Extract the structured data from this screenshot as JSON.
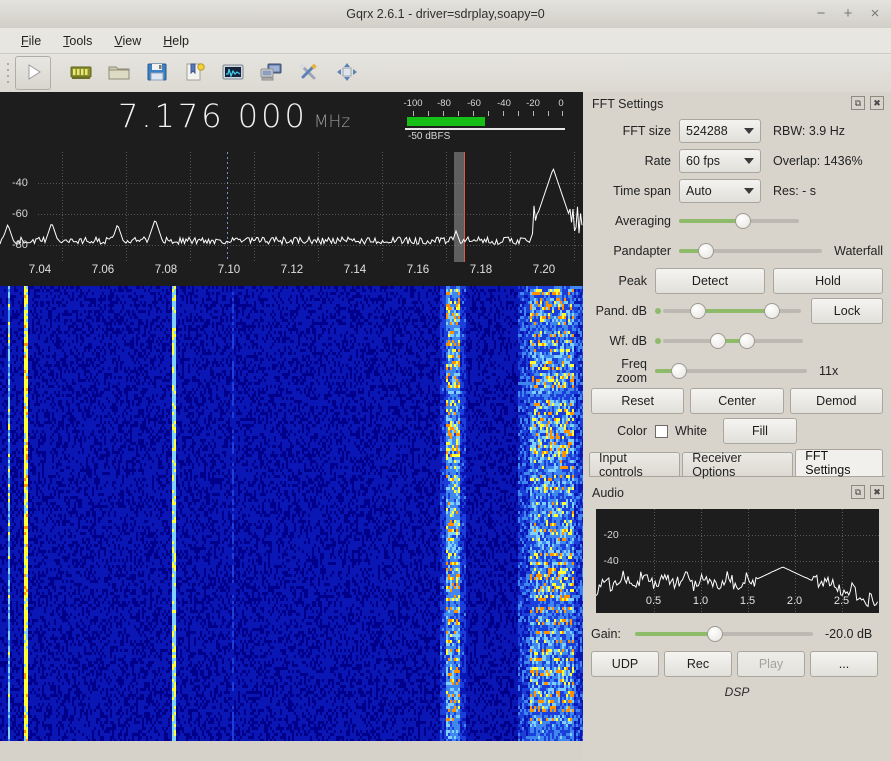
{
  "window": {
    "title": "Gqrx 2.6.1 - driver=sdrplay,soapy=0",
    "minimize": "−",
    "maximize": "+",
    "close": "×"
  },
  "menu": [
    {
      "label": "File",
      "mnemonic": "F"
    },
    {
      "label": "Tools",
      "mnemonic": "T"
    },
    {
      "label": "View",
      "mnemonic": "V"
    },
    {
      "label": "Help",
      "mnemonic": "H"
    }
  ],
  "toolbar": [
    {
      "name": "start-dsp-button",
      "icon": "play-icon"
    },
    {
      "name": "hardware-config-button",
      "icon": "chip-icon"
    },
    {
      "name": "load-settings-button",
      "icon": "folder-icon"
    },
    {
      "name": "save-settings-button",
      "icon": "floppy-disk-icon"
    },
    {
      "name": "bookmarks-button",
      "icon": "bookmark-icon"
    },
    {
      "name": "iq-recorder-button",
      "icon": "waveform-monitor-icon"
    },
    {
      "name": "remote-control-button",
      "icon": "remote-computer-icon"
    },
    {
      "name": "configure-button",
      "icon": "tools-icon"
    },
    {
      "name": "fullscreen-button",
      "icon": "move-arrows-icon"
    }
  ],
  "receiver": {
    "frequency_major": "7.176",
    "frequency_minor": "000",
    "unit": "MHz",
    "meter_level_label": "-50 dBFS",
    "meter_ticks": [
      "-100",
      "-80",
      "-60",
      "-40",
      "-20",
      "0"
    ],
    "meter_fill_percent": 50
  },
  "spectrum": {
    "y_labels": [
      "-40",
      "-60",
      "-80"
    ],
    "x_labels": [
      "7.04",
      "7.06",
      "7.08",
      "7.10",
      "7.12",
      "7.14",
      "7.16",
      "7.18",
      "7.20"
    ]
  },
  "fft": {
    "panel_title": "FFT Settings",
    "float_icon": "undock-icon",
    "close_icon": "close-icon",
    "fft_size_label": "FFT size",
    "fft_size_value": "524288",
    "rbw": "RBW: 3.9 Hz",
    "rate_label": "Rate",
    "rate_value": "60 fps",
    "overlap": "Overlap: 1436%",
    "time_span_label": "Time span",
    "time_span_value": "Auto",
    "res": "Res: - s",
    "averaging_label": "Averaging",
    "averaging_percent": 42,
    "pandapter_label": "Pandapter",
    "pandapter_percent": 18,
    "waterfall_label": "Waterfall",
    "peak_label": "Peak",
    "detect_label": "Detect",
    "hold_label": "Hold",
    "pand_db_label": "Pand. dB",
    "pand_db_low": 24,
    "pand_db_high": 76,
    "lock_label": "Lock",
    "wf_db_label": "Wf. dB",
    "wf_db_low": 38,
    "wf_db_high": 58,
    "freq_zoom_label": "Freq zoom",
    "freq_zoom_percent": 16,
    "freq_zoom_value": "11x",
    "reset_label": "Reset",
    "center_label": "Center",
    "demod_label": "Demod",
    "color_label": "Color",
    "white_label": "White",
    "white_checked": false,
    "fill_label": "Fill"
  },
  "tabs": [
    {
      "label": "Input controls",
      "active": false
    },
    {
      "label": "Receiver Options",
      "active": false
    },
    {
      "label": "FFT Settings",
      "active": true
    }
  ],
  "audio": {
    "panel_title": "Audio",
    "float_icon": "undock-icon",
    "close_icon": "close-icon",
    "gain_label": "Gain:",
    "gain_value": "-20.0 dB",
    "gain_percent": 45,
    "udp_label": "UDP",
    "rec_label": "Rec",
    "play_label": "Play",
    "play_enabled": false,
    "more_label": "...",
    "dsp_label": "DSP"
  },
  "chart_data": [
    {
      "type": "line",
      "name": "rf-spectrum",
      "title": "",
      "xlabel": "",
      "ylabel": "",
      "x_ticks": [
        7.04,
        7.06,
        7.08,
        7.1,
        7.12,
        7.14,
        7.16,
        7.18,
        7.2
      ],
      "y_ticks": [
        -40,
        -60,
        -80
      ],
      "xlim": [
        7.028,
        7.214
      ],
      "ylim": [
        -95,
        -28
      ],
      "marker_frequency": 7.176,
      "center_frequency": 7.1,
      "noise_floor": -82,
      "peaks": [
        {
          "x": 7.0305,
          "y": -72
        },
        {
          "x": 7.0445,
          "y": -71
        },
        {
          "x": 7.0655,
          "y": -72
        },
        {
          "x": 7.0775,
          "y": -69
        },
        {
          "x": 7.1735,
          "y": -76
        },
        {
          "x": 7.2005,
          "y": -63
        },
        {
          "x": 7.2045,
          "y": -38
        },
        {
          "x": 7.2075,
          "y": -58
        }
      ]
    },
    {
      "type": "line",
      "name": "audio-spectrum",
      "title": "",
      "xlabel": "",
      "ylabel": "",
      "x_ticks": [
        0.5,
        1.0,
        1.5,
        2.0,
        2.5
      ],
      "y_ticks": [
        -20,
        -40
      ],
      "xlim": [
        0.0,
        3.0
      ],
      "ylim": [
        -60,
        -8
      ],
      "baseline": -44,
      "peaks": [
        {
          "x": 1.98,
          "y": -37
        }
      ]
    },
    {
      "type": "heatmap",
      "name": "waterfall",
      "xlim": [
        7.028,
        7.214
      ],
      "colors": [
        "#00008b",
        "#0000ff",
        "#4aa3ff",
        "#ffff00",
        "#ff8c00"
      ],
      "strong_signal_frequencies": [
        7.172,
        7.204,
        7.036,
        7.083
      ]
    }
  ]
}
